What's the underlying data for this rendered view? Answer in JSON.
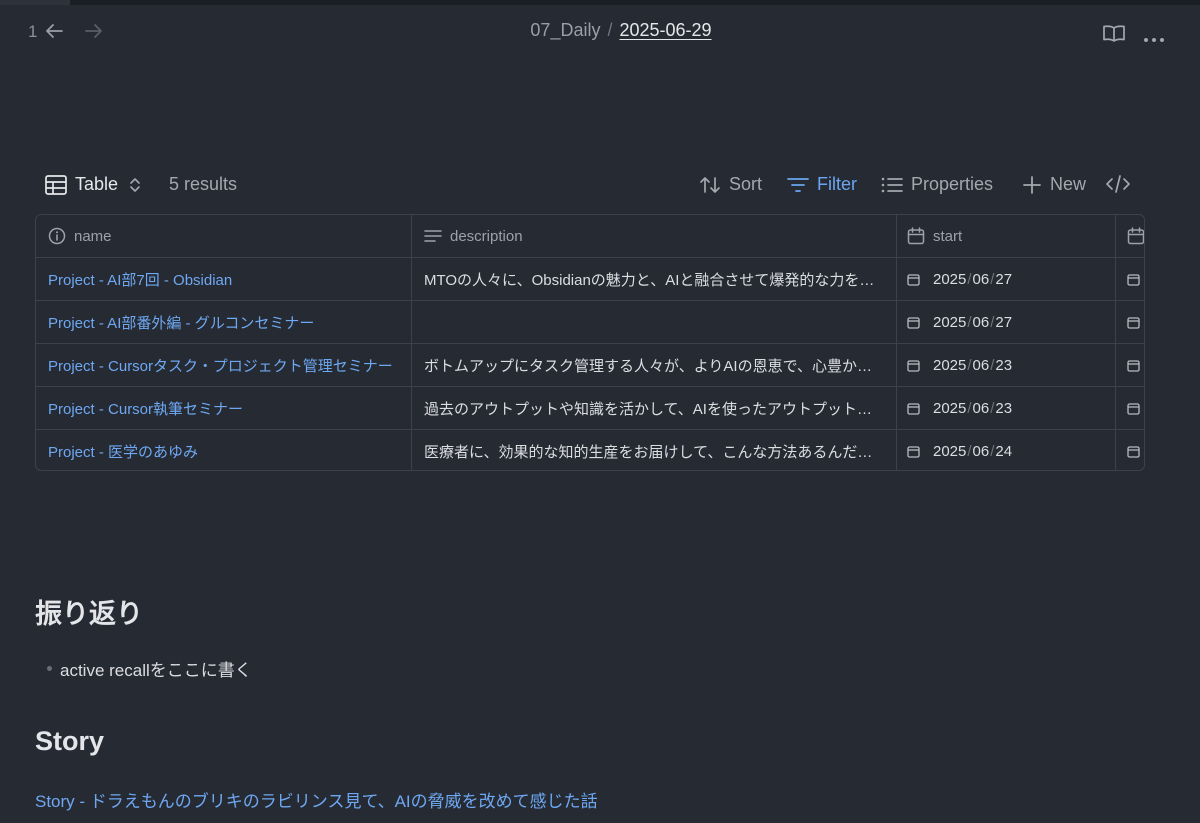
{
  "nav": {
    "history_count": "1"
  },
  "breadcrumb": {
    "folder": "07_Daily",
    "separator": "/",
    "current": "2025-06-29"
  },
  "toolbar": {
    "view_label": "Table",
    "results": "5 results",
    "sort_label": "Sort",
    "filter_label": "Filter",
    "properties_label": "Properties",
    "new_label": "New"
  },
  "table": {
    "columns": {
      "name": "name",
      "description": "description",
      "start": "start"
    },
    "rows": [
      {
        "name": "Project - AI部7回 - Obsidian",
        "description": "MTOの人々に、Obsidianの魅力と、AIと融合させて爆発的な力を…",
        "start": {
          "y": "2025",
          "m": "06",
          "d": "27"
        }
      },
      {
        "name": "Project - AI部番外編 - グルコンセミナー",
        "description": "",
        "start": {
          "y": "2025",
          "m": "06",
          "d": "27"
        }
      },
      {
        "name": "Project - Cursorタスク・プロジェクト管理セミナー",
        "description": "ボトムアップにタスク管理する人々が、よりAIの恩恵で、心豊かに…",
        "start": {
          "y": "2025",
          "m": "06",
          "d": "23"
        }
      },
      {
        "name": "Project - Cursor執筆セミナー",
        "description": "過去のアウトプットや知識を活かして、AIを使ったアウトプット手…",
        "start": {
          "y": "2025",
          "m": "06",
          "d": "23"
        }
      },
      {
        "name": "Project - 医学のあゆみ",
        "description": "医療者に、効果的な知的生産をお届けして、こんな方法あるんだ！…",
        "start": {
          "y": "2025",
          "m": "06",
          "d": "24"
        }
      }
    ]
  },
  "content": {
    "review_heading": "振り返り",
    "review_bullet": "active recallをここに書く",
    "story_heading": "Story",
    "story_link": "Story - ドラえもんのブリキのラビリンス見て、AIの脅威を改めて感じた話"
  },
  "colors": {
    "background": "#262a33",
    "link": "#6ea8f2",
    "filter_active": "#6aa6f0",
    "border": "#3d414a"
  }
}
